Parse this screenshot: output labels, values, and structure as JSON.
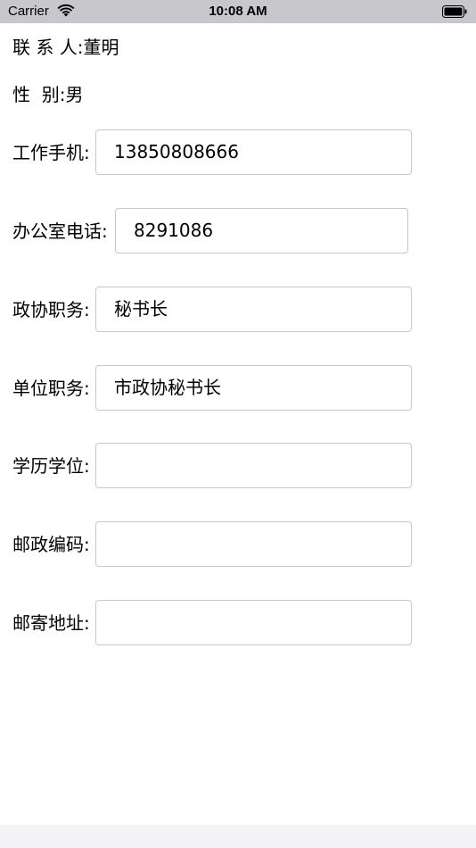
{
  "status_bar": {
    "carrier": "Carrier",
    "time": "10:08 AM"
  },
  "contact": {
    "name_label": "联 系 人:",
    "name_value": "董明",
    "gender_label": "性  别:",
    "gender_value": "男"
  },
  "fields": [
    {
      "label": "工作手机:",
      "value": "13850808666"
    },
    {
      "label": "办公室电话:",
      "value": "8291086"
    },
    {
      "label": "政协职务:",
      "value": "秘书长"
    },
    {
      "label": "单位职务:",
      "value": "市政协秘书长"
    },
    {
      "label": "学历学位:",
      "value": ""
    },
    {
      "label": "邮政编码:",
      "value": ""
    },
    {
      "label": "邮寄地址:",
      "value": ""
    }
  ],
  "colors": {
    "status_bar_bg": "#c8c8cc",
    "input_border": "#c7c7cc",
    "home_bar_bg": "#f4f4f6"
  }
}
